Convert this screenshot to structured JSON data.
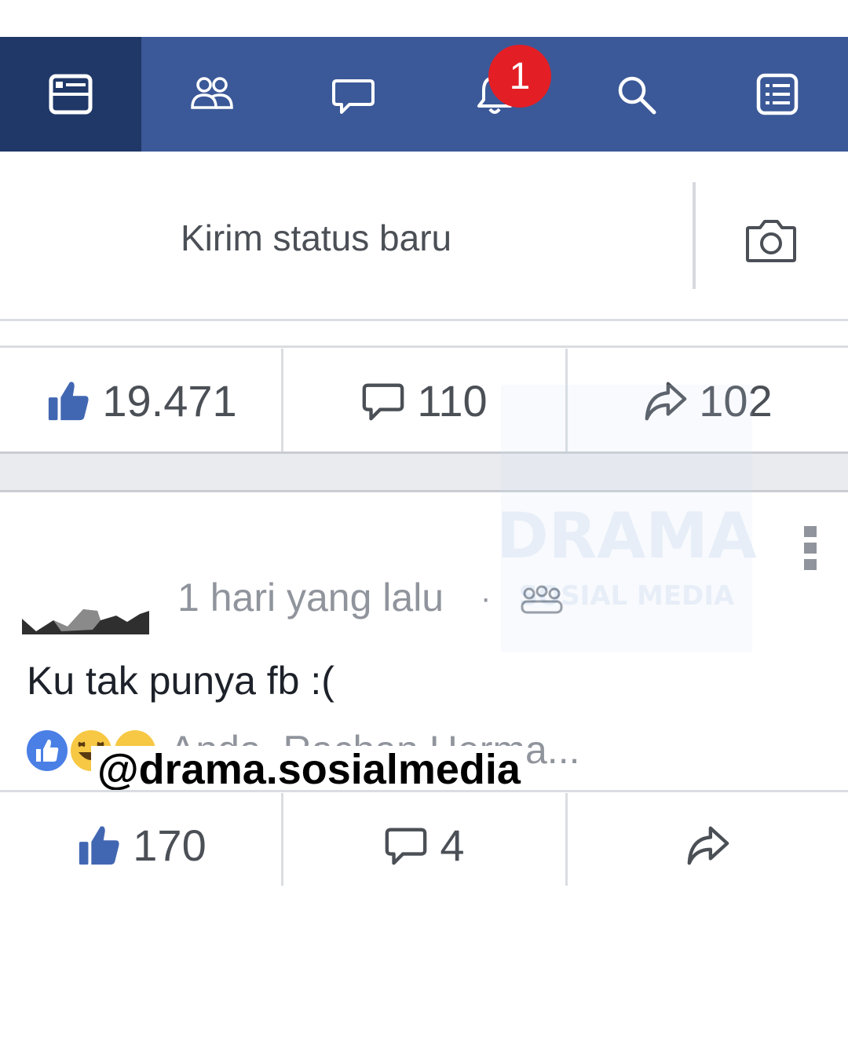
{
  "navbar": {
    "items": [
      {
        "icon": "news-feed-icon",
        "active": true
      },
      {
        "icon": "friends-icon",
        "active": false
      },
      {
        "icon": "messages-icon",
        "active": false
      },
      {
        "icon": "notifications-icon",
        "active": false
      },
      {
        "icon": "search-icon",
        "active": false
      },
      {
        "icon": "menu-icon",
        "active": false
      }
    ],
    "notification_count": "1"
  },
  "composer": {
    "placeholder": "Kirim status baru",
    "camera_icon": "camera-icon"
  },
  "post1": {
    "likes": "19.471",
    "comments": "110",
    "shares": "102"
  },
  "post2": {
    "time": "1 hari yang lalu",
    "separator": "·",
    "audience_icon": "group-icon",
    "text": "Ku tak punya fb :(",
    "reaction_icons": [
      "like-reaction-icon",
      "haha-reaction-icon",
      "haha-reaction-icon"
    ],
    "reaction_names": "Anda, Rachan Herma...",
    "likes": "170",
    "comments": "4"
  },
  "watermark": {
    "handle": "@drama.sosialmedia",
    "logo_text": "DRAMA",
    "logo_subtext": "SOSIAL MEDIA"
  },
  "colors": {
    "nav_bg": "#3b5998",
    "nav_active_bg": "#203868",
    "badge": "#e41e25",
    "like_blue": "#4267b2"
  }
}
